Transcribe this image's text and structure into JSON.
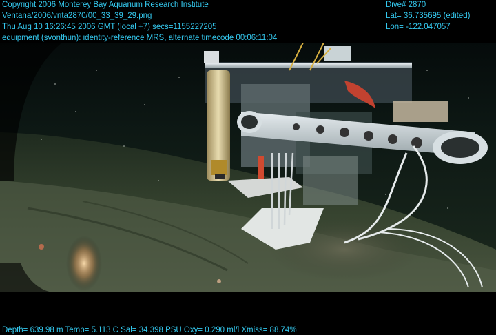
{
  "overlay": {
    "text_color": "#34c8ee",
    "top_left": [
      "Copyright 2006 Monterey Bay Aquarium Research Institute",
      "Ventana/2006/vnta2870/00_33_39_29.png",
      "Thu Aug 10 16:26:45 2006 GMT (local +7)  secs=1155227205",
      "equipment (svonthun): identity-reference MRS, alternate timecode 00:06:11:04"
    ],
    "top_right": [
      "Dive# 2870",
      "Lat= 36.735695 (edited)",
      "Lon= -122.047057"
    ],
    "bottom": "Depth= 639.98 m  Temp= 5.113 C  Sal= 34.398 PSU  Oxy= 0.290 ml/l  Xmiss= 88.74%"
  }
}
